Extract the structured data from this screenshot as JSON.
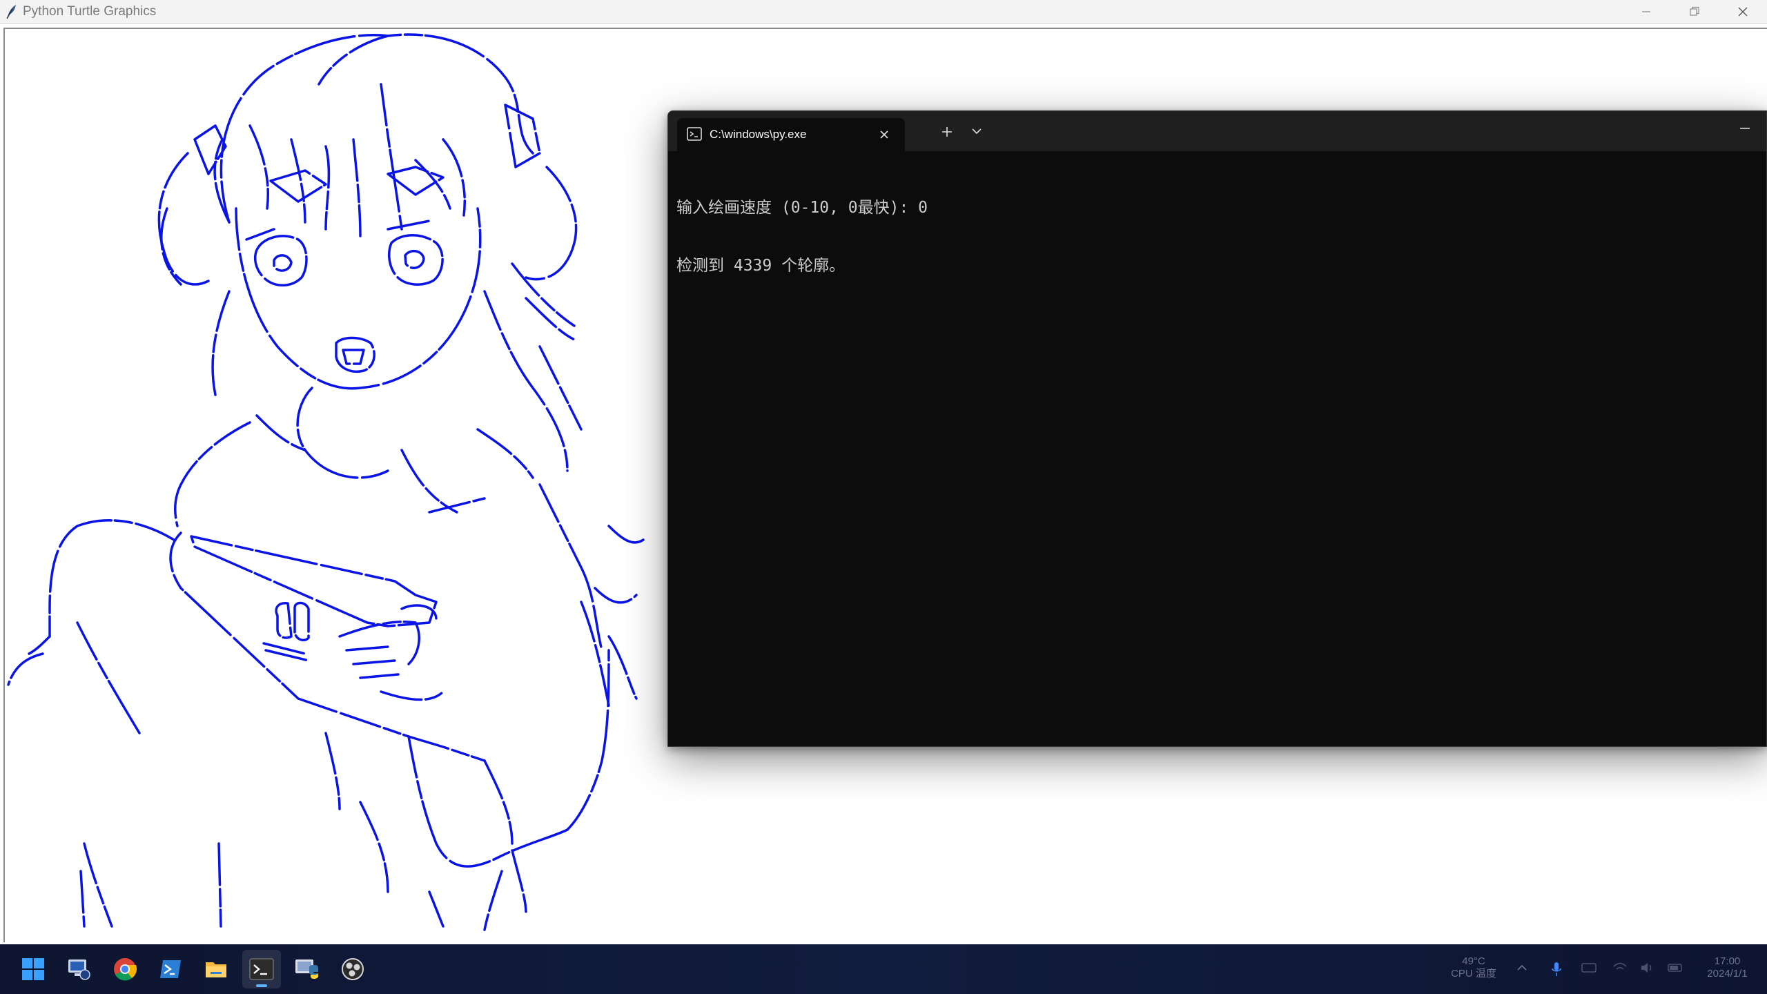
{
  "window": {
    "title": "Python Turtle Graphics"
  },
  "canvas": {
    "pen_color": "#0a14e6",
    "content": "line drawing of anime girl holding a Nintendo Switch"
  },
  "terminal": {
    "tab_title": "C:\\windows\\py.exe",
    "lines": [
      "输入绘画速度 (0-10, 0最快): 0",
      "检测到 4339 个轮廓。"
    ]
  },
  "taskbar": {
    "apps": [
      {
        "name": "start"
      },
      {
        "name": "remote-desktop"
      },
      {
        "name": "chrome"
      },
      {
        "name": "powershell"
      },
      {
        "name": "file-explorer"
      },
      {
        "name": "terminal",
        "active": true
      },
      {
        "name": "python-turtle"
      },
      {
        "name": "obs-studio"
      }
    ],
    "weather": {
      "temp": "49°C",
      "desc": "CPU 温度"
    },
    "clock": {
      "time": "17:00",
      "date": "2024/1/1"
    }
  }
}
